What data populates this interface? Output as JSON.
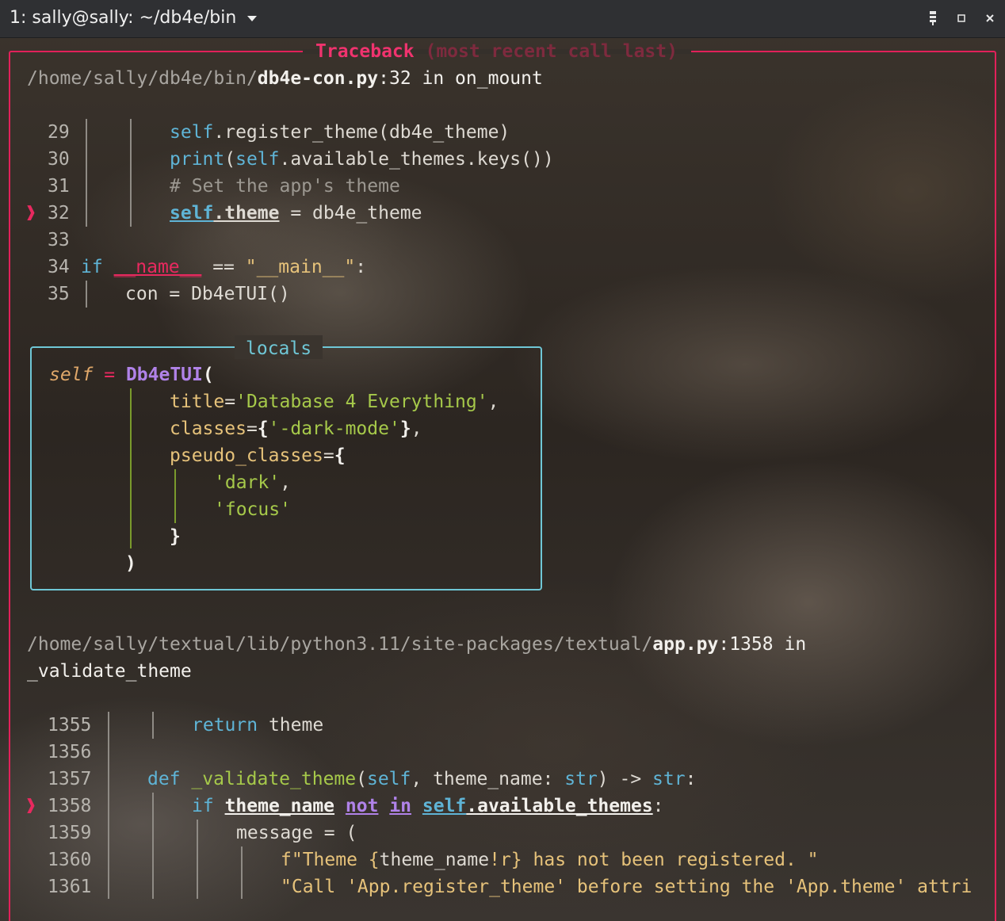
{
  "window": {
    "title": "1: sally@sally: ~/db4e/bin",
    "icons": [
      "terminal-menu-icon",
      "maximize-icon",
      "close-icon"
    ]
  },
  "traceback": {
    "title_main": "Traceback",
    "title_rest": " (most recent call last)"
  },
  "frame1": {
    "path_prefix": "/home/sally/db4e/bin/",
    "file": "db4e-con.py",
    "location": ":32 in on_mount",
    "lines": {
      "l29": "29",
      "l30": "30",
      "l31": "31",
      "l32": "32",
      "l33": "33",
      "l34": "34",
      "l35": "35"
    },
    "marker": "❱",
    "code": {
      "c29_a": "self",
      "c29_b": ".register_theme(db4e_theme)",
      "c30_a": "print",
      "c30_b": "(",
      "c30_c": "self",
      "c30_d": ".available_themes.keys())",
      "c31": "# Set the app's theme",
      "c32_a": "self",
      "c32_b": ".theme",
      "c32_c": " = db4e_theme",
      "c34_a": "if",
      "c34_b": " ",
      "c34_c": "__name__",
      "c34_d": " == ",
      "c34_e": "\"__main__\"",
      "c34_f": ":",
      "c35": "con = Db4eTUI()"
    }
  },
  "locals": {
    "title": "locals",
    "self_name": "self",
    "eq": " = ",
    "class_name": "Db4eTUI",
    "open_paren": "(",
    "title_key": "title",
    "title_val": "'Database 4 Everything'",
    "classes_key": "classes",
    "classes_val": "'-dark-mode'",
    "pseudo_key": "pseudo_classes",
    "pseudo_1": "'dark'",
    "pseudo_2": "'focus'",
    "close_brace": "}",
    "close_paren": ")"
  },
  "frame2": {
    "path_prefix": "/home/sally/textual/lib/python3.11/site-packages/textual/",
    "file": "app.py",
    "location": ":1358 in",
    "location_2": "_validate_theme",
    "lines": {
      "l1355": "1355",
      "l1356": "1356",
      "l1357": "1357",
      "l1358": "1358",
      "l1359": "1359",
      "l1360": "1360",
      "l1361": "1361"
    },
    "code": {
      "c1355_a": "return",
      "c1355_b": " theme",
      "c1357_a": "def",
      "c1357_b": " ",
      "c1357_c": "_validate_theme",
      "c1357_d": "(",
      "c1357_e": "self",
      "c1357_f": ", theme_name: ",
      "c1357_g": "str",
      "c1357_h": ") -> ",
      "c1357_i": "str",
      "c1357_j": ":",
      "c1358_a": "if",
      "c1358_b": "theme_name",
      "c1358_c": "not",
      "c1358_d": "in",
      "c1358_e": "self",
      "c1358_f": ".available_themes",
      "c1358_g": ":",
      "c1359": "message = (",
      "c1360_a": "f\"Theme {",
      "c1360_b": "theme_name",
      "c1360_c": "!r}",
      "c1360_d": " has not been registered. \"",
      "c1361": "\"Call 'App.register_theme' before setting the 'App.theme' attri"
    }
  }
}
